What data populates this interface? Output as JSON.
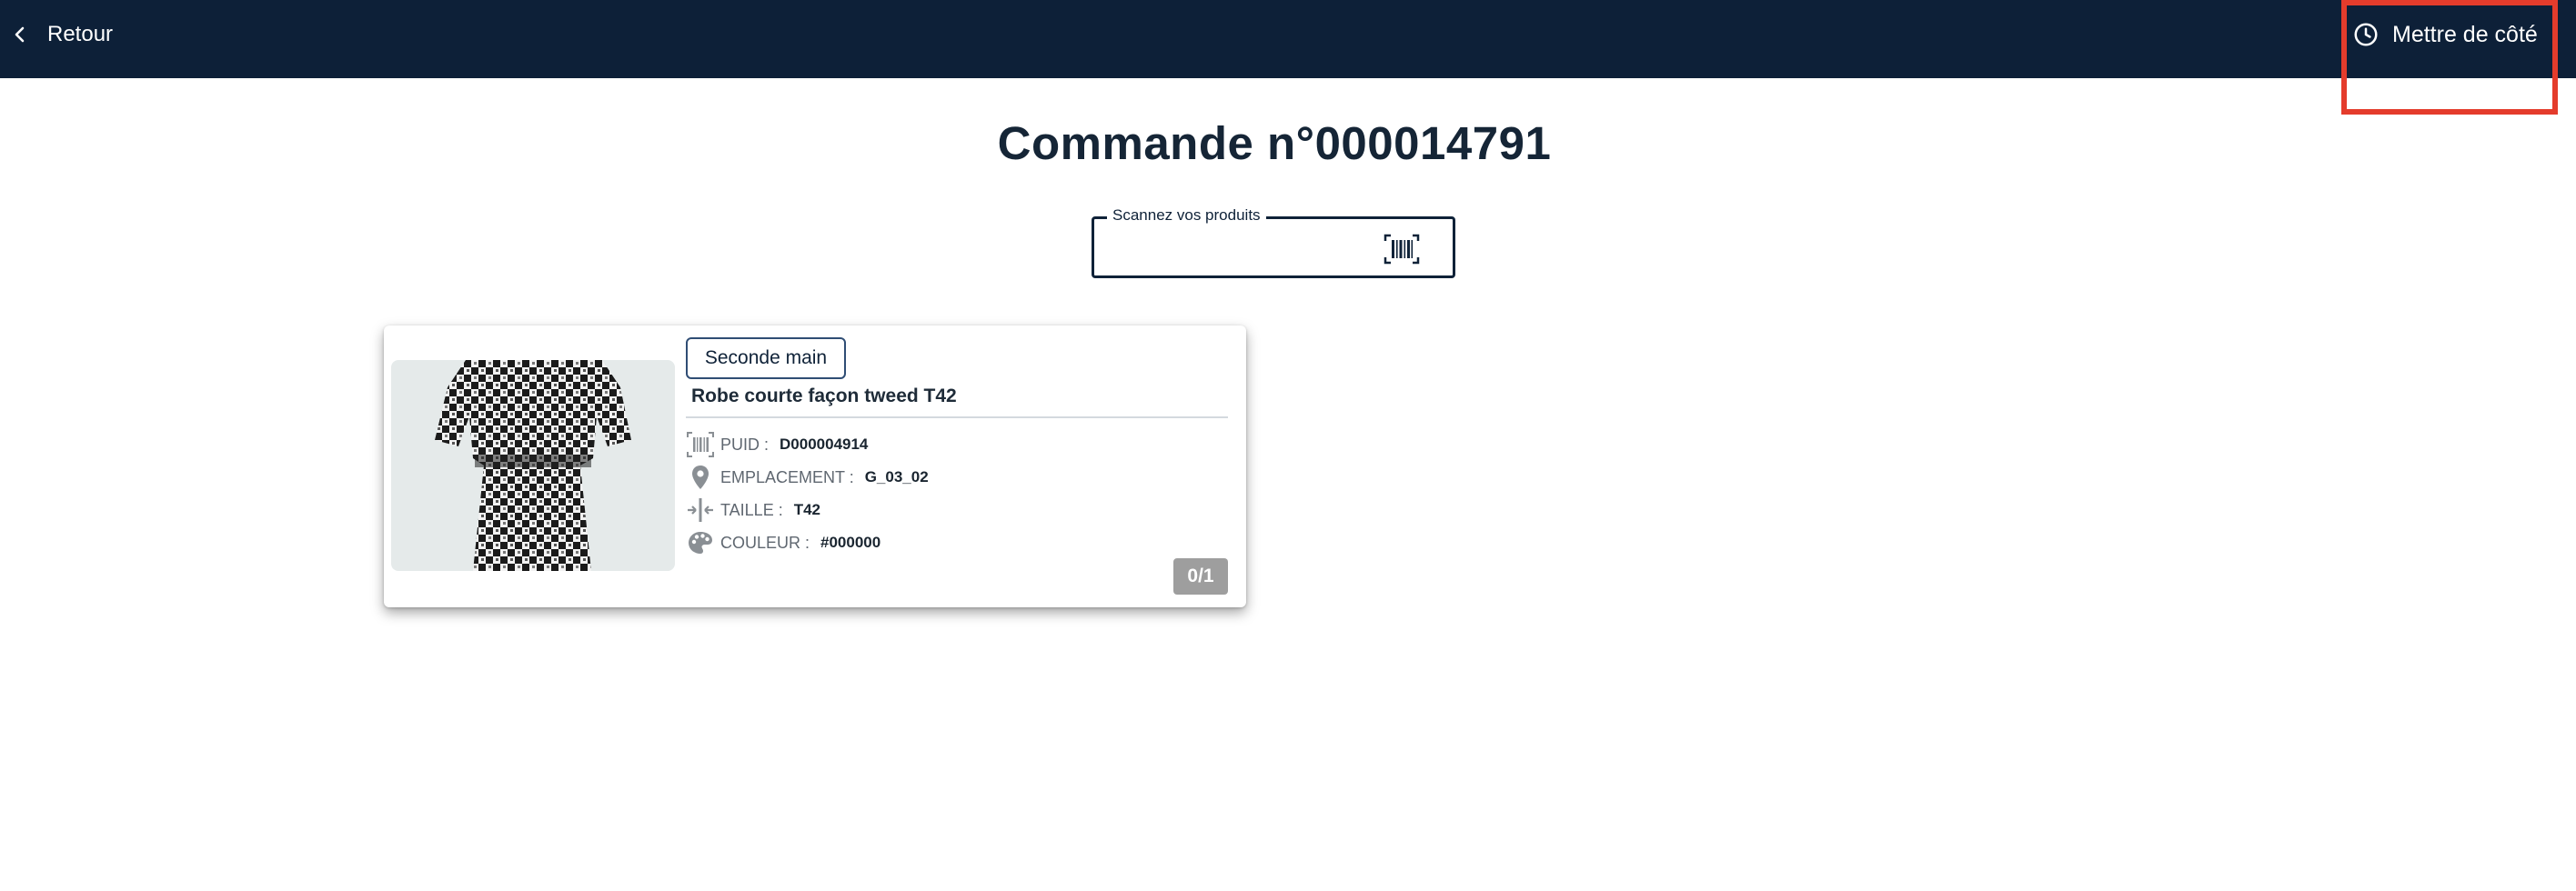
{
  "header": {
    "back_label": "Retour",
    "set_aside_label": "Mettre de côté"
  },
  "page": {
    "title": "Commande n°000014791"
  },
  "scan": {
    "label": "Scannez vos produits",
    "value": ""
  },
  "product": {
    "tag": "Seconde main",
    "name": "Robe courte façon tweed T42",
    "attributes": [
      {
        "icon": "barcode-icon",
        "label": "PUID :",
        "value": "D000004914"
      },
      {
        "icon": "location-pin-icon",
        "label": "EMPLACEMENT :",
        "value": "G_03_02"
      },
      {
        "icon": "size-icon",
        "label": "TAILLE :",
        "value": "T42"
      },
      {
        "icon": "palette-icon",
        "label": "COULEUR :",
        "value": "#000000"
      }
    ],
    "count": "0/1"
  },
  "colors": {
    "header_bg": "#0d2038",
    "highlight": "#e43c2c",
    "count_badge": "#9e9e9e"
  }
}
